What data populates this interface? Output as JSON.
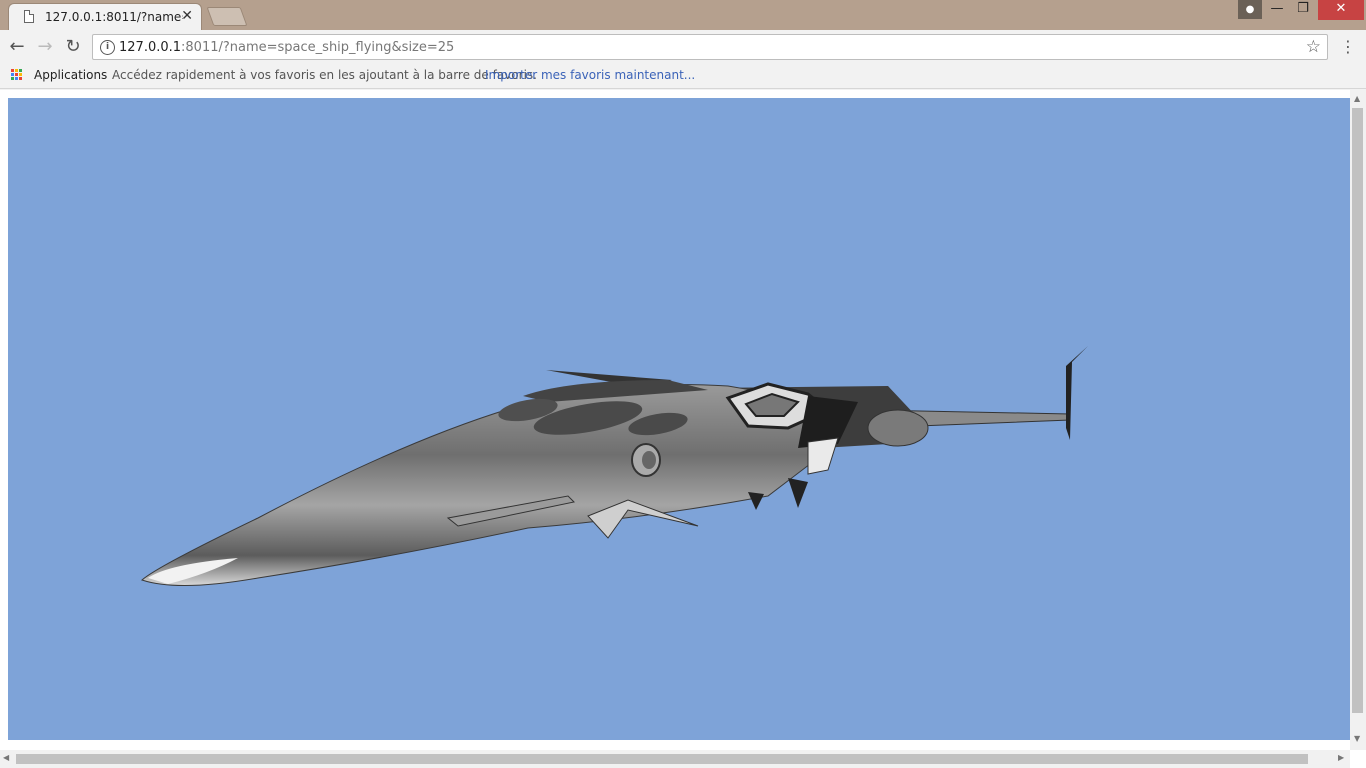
{
  "browser": {
    "tab_title": "127.0.0.1:8011/?name=space_ship_flying&size=25",
    "url_host": "127.0.0.1",
    "url_rest": ":8011/?name=space_ship_flying&size=25"
  },
  "bookmarks": {
    "apps_label": "Applications",
    "hint": "Accédez rapidement à vos favoris en les ajoutant à la barre de favoris.",
    "import_link": "Importer mes favoris maintenant..."
  },
  "scene": {
    "background_color": "#7ea3d8",
    "subject": "space-ship"
  },
  "icons": [
    "page-icon",
    "close-icon",
    "profile-icon",
    "minimize-icon",
    "maximize-icon",
    "close-window-icon",
    "back-icon",
    "forward-icon",
    "reload-icon",
    "info-icon",
    "star-icon",
    "menu-icon",
    "apps-icon"
  ]
}
